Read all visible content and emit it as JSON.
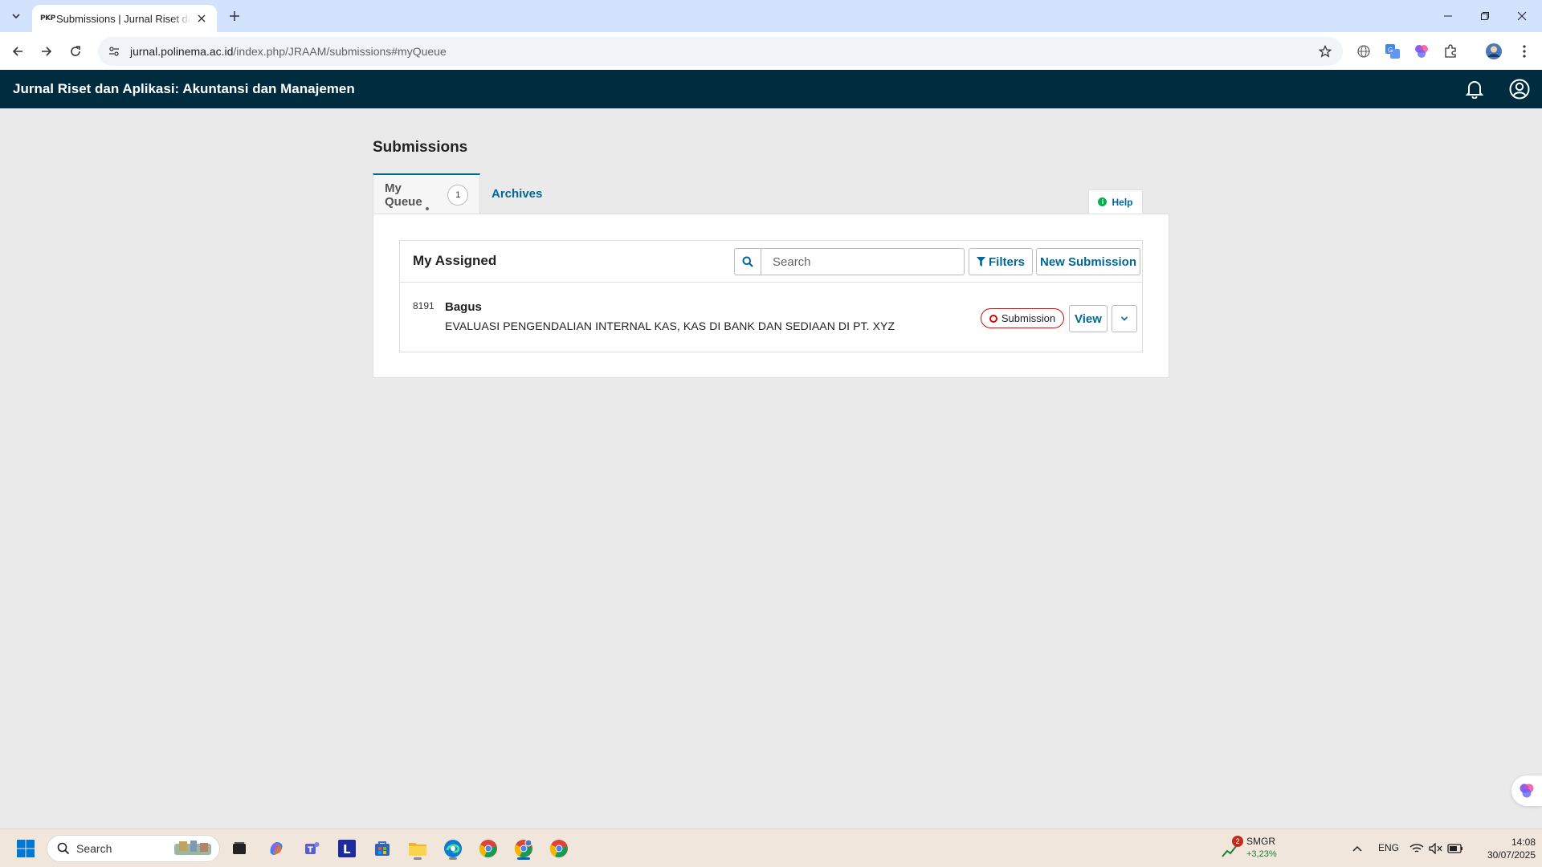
{
  "browser": {
    "tab_favicon": "PKP",
    "tab_title": "Submissions | Jurnal Riset dan Aplikasi: Akuntansi dan Manajemen",
    "url_host": "jurnal.polinema.ac.id",
    "url_path": "/index.php/JRAAM/submissions#myQueue"
  },
  "app": {
    "title": "Jurnal Riset dan Aplikasi: Akuntansi dan Manajemen"
  },
  "page": {
    "title": "Submissions",
    "tabs": [
      {
        "label": "My Queue",
        "count": "1"
      },
      {
        "label": "Archives"
      }
    ],
    "help_label": "Help"
  },
  "listing": {
    "title": "My Assigned",
    "search_placeholder": "Search",
    "filters_label": "Filters",
    "new_submission_label": "New Submission",
    "items": [
      {
        "id": "8191",
        "author": "Bagus",
        "title": "EVALUASI PENGENDALIAN INTERNAL KAS, KAS DI BANK DAN SEDIAAN DI PT. XYZ",
        "stage": "Submission",
        "view_label": "View"
      }
    ]
  },
  "taskbar": {
    "search_label": "Search",
    "stock": {
      "name": "SMGR",
      "change": "+3,23%",
      "badge": "2"
    },
    "lang": "ENG",
    "time": "14:08",
    "date": "30/07/2025"
  },
  "colors": {
    "header_bg": "#002c40",
    "link": "#006798",
    "stage": "#d00a0a"
  }
}
